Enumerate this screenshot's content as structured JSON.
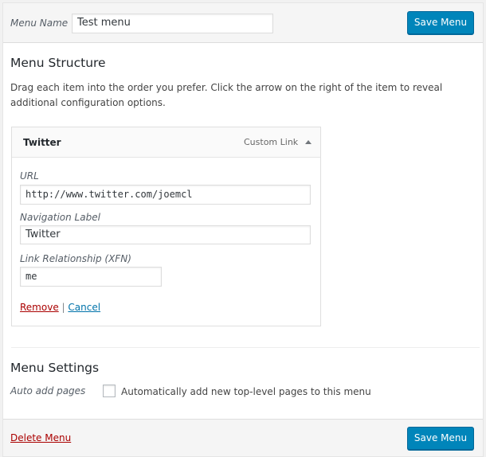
{
  "header": {
    "menu_name_label": "Menu Name",
    "menu_name_value": "Test menu",
    "save_label": "Save Menu"
  },
  "structure": {
    "title": "Menu Structure",
    "description": "Drag each item into the order you prefer. Click the arrow on the right of the item to reveal additional configuration options.",
    "item": {
      "title": "Twitter",
      "type": "Custom Link",
      "icon": "arrow-up-icon",
      "url_label": "URL",
      "url_value": "http://www.twitter.com/joemcl",
      "nav_label_label": "Navigation Label",
      "nav_label_value": "Twitter",
      "xfn_label": "Link Relationship (XFN)",
      "xfn_value": "me",
      "remove_label": "Remove",
      "separator": "|",
      "cancel_label": "Cancel"
    }
  },
  "settings": {
    "title": "Menu Settings",
    "auto_add_label": "Auto add pages",
    "auto_add_text": "Automatically add new top-level pages to this menu",
    "auto_add_checked": false
  },
  "footer": {
    "delete_label": "Delete Menu",
    "save_label": "Save Menu"
  },
  "colors": {
    "primary": "#0085ba",
    "delete": "#a00",
    "link": "#0073aa"
  }
}
